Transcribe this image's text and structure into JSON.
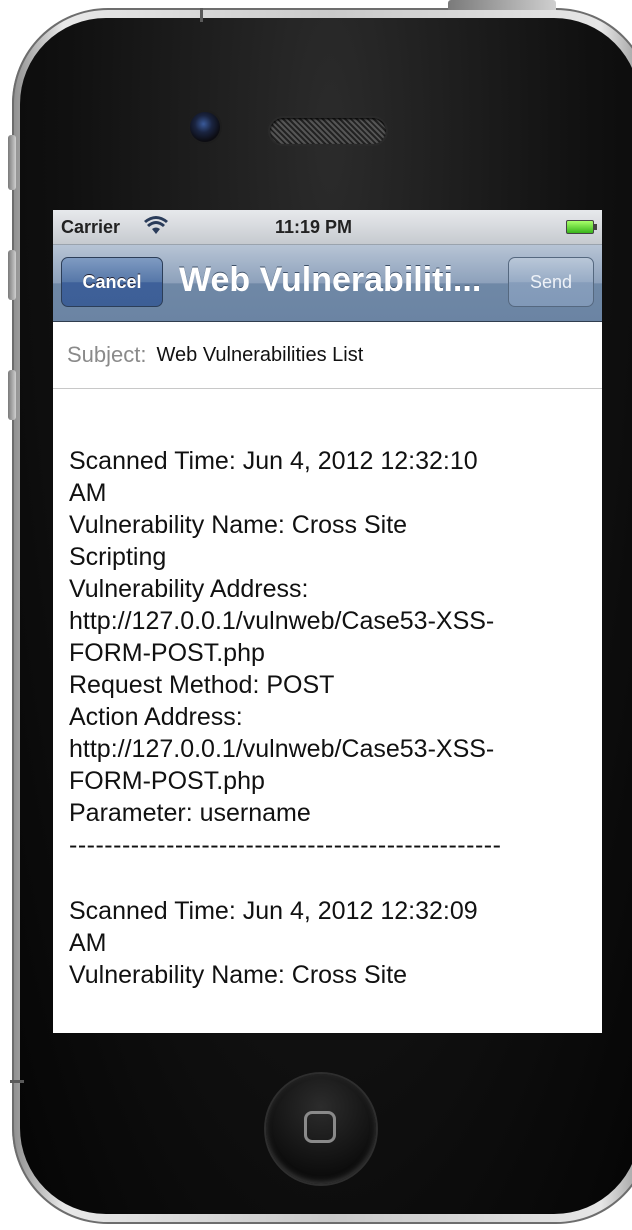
{
  "status_bar": {
    "carrier": "Carrier",
    "wifi_icon": "wifi-icon",
    "time": "11:19 PM",
    "battery_icon": "battery-full-icon"
  },
  "nav_bar": {
    "cancel_label": "Cancel",
    "title": "Web Vulnerabiliti...",
    "send_label": "Send"
  },
  "subject": {
    "label": "Subject:",
    "value": "Web Vulnerabilities List"
  },
  "body": {
    "entry1": {
      "scanned_time_1": "Scanned Time: Jun 4, 2012 12:32:10",
      "scanned_time_2": "AM",
      "vuln_name_1": "Vulnerability Name: Cross Site",
      "vuln_name_2": "Scripting",
      "vuln_address_label": "Vulnerability Address:",
      "vuln_address_1": "http://127.0.0.1/vulnweb/Case53-XSS-",
      "vuln_address_2": "FORM-POST.php",
      "request_method": "Request Method: POST",
      "action_address_label": "Action Address:",
      "action_address_1": "http://127.0.0.1/vulnweb/Case53-XSS-",
      "action_address_2": "FORM-POST.php",
      "parameter": "Parameter: username"
    },
    "separator": "-------------------------------------------------",
    "entry2": {
      "scanned_time_1": "Scanned Time: Jun 4, 2012 12:32:09",
      "scanned_time_2": "AM",
      "vuln_name_1": "Vulnerability Name: Cross Site"
    }
  }
}
